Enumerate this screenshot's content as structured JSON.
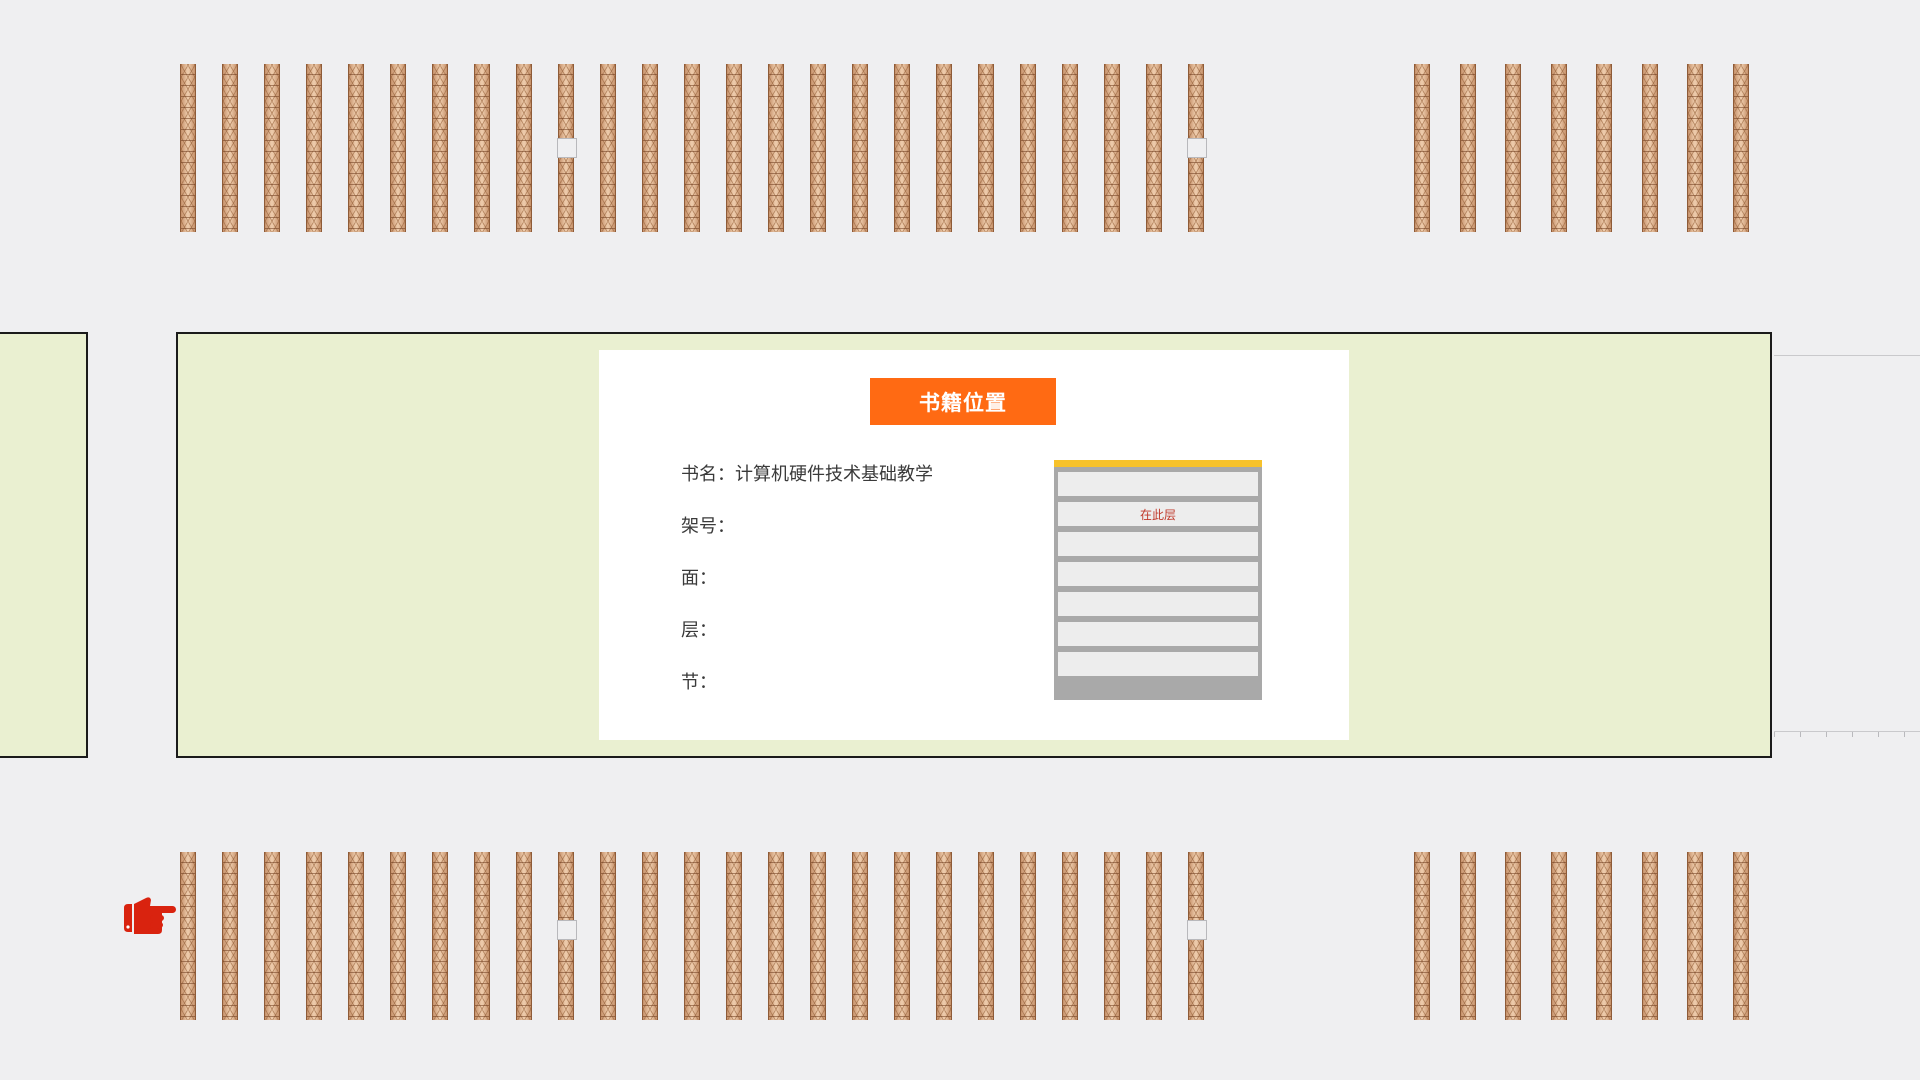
{
  "panel": {
    "title": "书籍位置",
    "book_name_label": "书名：",
    "book_name_value": "计算机硬件技术基础教学",
    "shelf_number_label": "架号：",
    "face_label": "面：",
    "layer_label": "层：",
    "section_label": "节："
  },
  "shelf_diagram": {
    "layer_count": 7,
    "highlight_layer_index": 1,
    "highlight_label": "在此层"
  },
  "shelves": {
    "left_group_count": 25,
    "right_group_count": 8
  },
  "icons": {
    "pointer": "pointing-hand-icon"
  },
  "colors": {
    "background": "#efeff1",
    "zone": "#eaf0d1",
    "accent": "#ff6a13",
    "shelf_top": "#f7c22b",
    "highlight_text": "#c0392b",
    "pointer": "#d9230f"
  }
}
